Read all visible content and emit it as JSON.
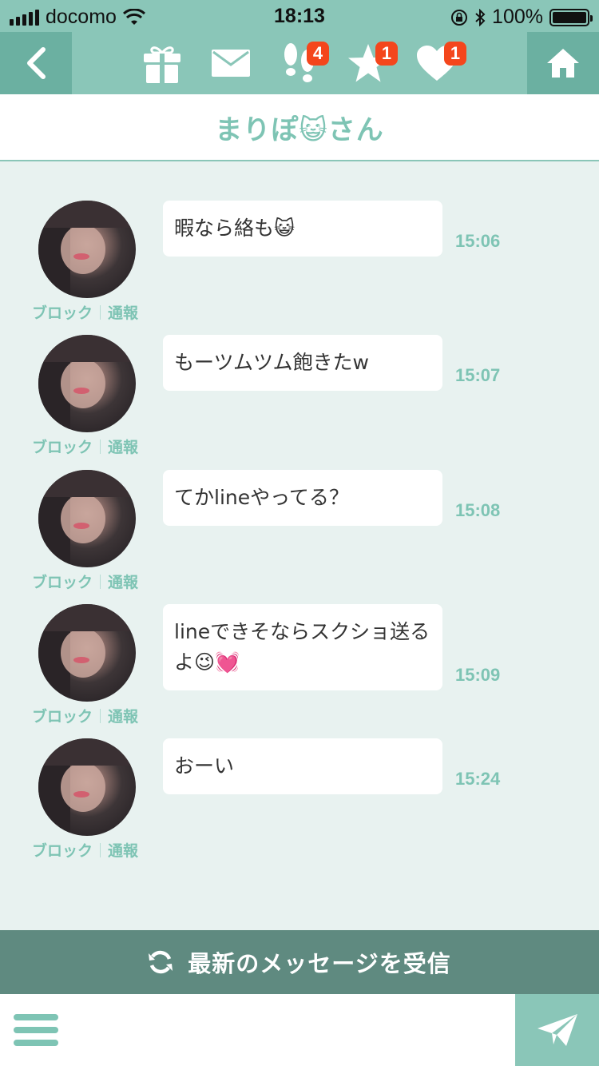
{
  "status_bar": {
    "carrier": "docomo",
    "time": "18:13",
    "battery": "100%"
  },
  "nav": {
    "icons": [
      {
        "name": "gift",
        "badge": ""
      },
      {
        "name": "mail",
        "badge": ""
      },
      {
        "name": "footprints",
        "badge": "4"
      },
      {
        "name": "star",
        "badge": "1"
      },
      {
        "name": "heart",
        "badge": "1"
      }
    ]
  },
  "title": "まりぽ😺さん",
  "messages": [
    {
      "text": "暇なら絡も😺",
      "time": "15:06",
      "block": "ブロック",
      "report": "通報"
    },
    {
      "text": "もーツムツム飽きたw",
      "time": "15:07",
      "block": "ブロック",
      "report": "通報"
    },
    {
      "text": "てかlineやってる？",
      "time": "15:08",
      "block": "ブロック",
      "report": "通報"
    },
    {
      "text": "lineできそならスクショ送るよ😉💓",
      "time": "15:09",
      "block": "ブロック",
      "report": "通報"
    },
    {
      "text": "おーい",
      "time": "15:24",
      "block": "ブロック",
      "report": "通報"
    }
  ],
  "receive_button": "最新のメッセージを受信",
  "input": {
    "placeholder": "",
    "value": ""
  },
  "colors": {
    "accent": "#8ac6b8",
    "accent_dark": "#6bb0a1",
    "receive_bg": "#5f8a80",
    "badge": "#f4461c",
    "chat_bg": "#e8f2f0",
    "text_accent": "#7ec4b4"
  }
}
